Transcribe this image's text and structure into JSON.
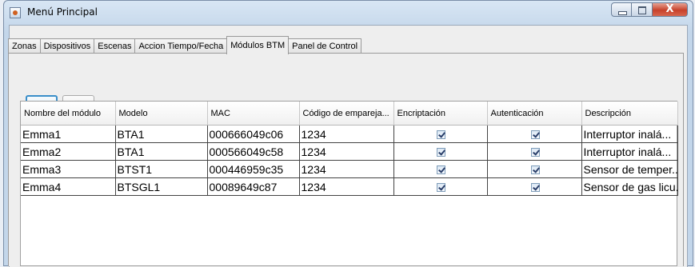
{
  "window": {
    "title": "Menú Principal",
    "close_label": "X"
  },
  "tabs": [
    {
      "label": "Zonas"
    },
    {
      "label": "Dispositivos"
    },
    {
      "label": "Escenas"
    },
    {
      "label": "Accion Tiempo/Fecha"
    },
    {
      "label": "Módulos BTM",
      "active": true
    },
    {
      "label": "Panel de Control"
    }
  ],
  "toolbar": {
    "add_icon": "green-plus-icon",
    "remove_icon": "red-minus-icon"
  },
  "table": {
    "headers": [
      "Nombre del módulo",
      "Modelo",
      "MAC",
      "Código de empareja...",
      "Encriptación",
      "Autenticación",
      "Descripción"
    ],
    "rows": [
      {
        "nombre": "Emma1",
        "modelo": "BTA1",
        "mac": "000666049c06",
        "codigo": "1234",
        "encriptacion": true,
        "autenticacion": true,
        "descripcion": "Interruptor inalá..."
      },
      {
        "nombre": "Emma2",
        "modelo": "BTA1",
        "mac": "000566049c58",
        "codigo": "1234",
        "encriptacion": true,
        "autenticacion": true,
        "descripcion": "Interruptor inalá..."
      },
      {
        "nombre": "Emma3",
        "modelo": "BTST1",
        "mac": "000446959c35",
        "codigo": "1234",
        "encriptacion": true,
        "autenticacion": true,
        "descripcion": "Sensor de temper..."
      },
      {
        "nombre": "Emma4",
        "modelo": "BTSGL1",
        "mac": "00089649c87",
        "codigo": "1234",
        "encriptacion": true,
        "autenticacion": true,
        "descripcion": "Sensor de gas licu..."
      }
    ]
  }
}
